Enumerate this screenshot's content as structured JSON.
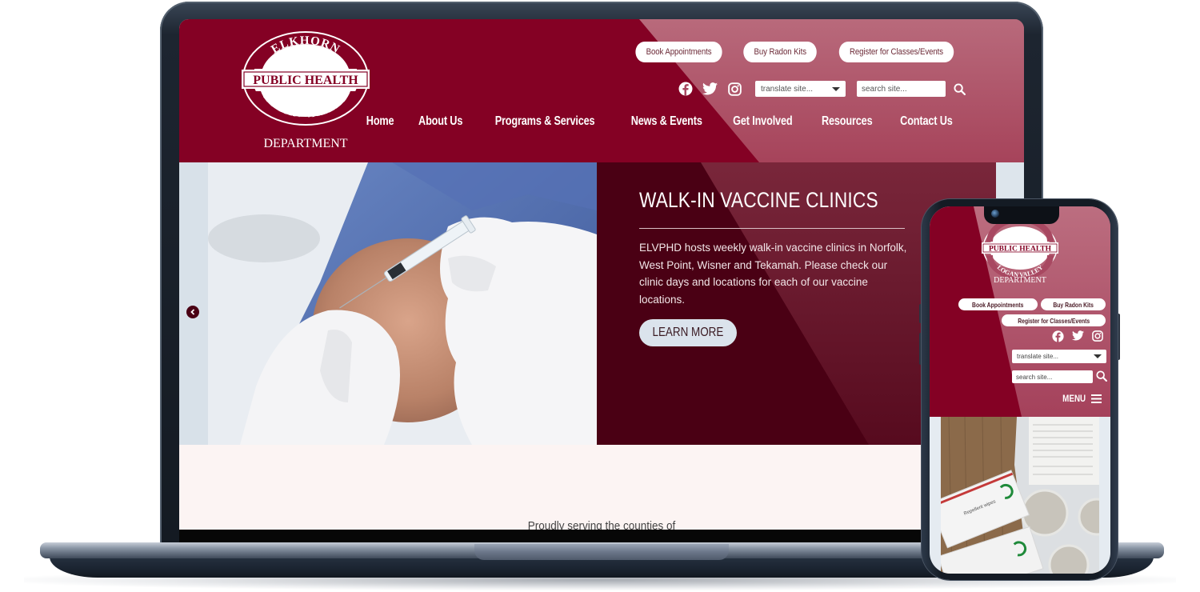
{
  "site": {
    "logo": {
      "top_text": "ELKHORN",
      "band_text": "PUBLIC HEALTH",
      "bottom_text": "LOGAN VALLEY",
      "department": "DEPARTMENT"
    },
    "utility_buttons": [
      {
        "label": "Book Appointments"
      },
      {
        "label": "Buy Radon Kits"
      },
      {
        "label": "Register for Classes/Events"
      }
    ],
    "social": [
      {
        "icon": "facebook-icon"
      },
      {
        "icon": "twitter-icon"
      },
      {
        "icon": "instagram-icon"
      }
    ],
    "translate": {
      "selected": "translate site..."
    },
    "search": {
      "placeholder": "search site..."
    },
    "nav": [
      {
        "label": "Home"
      },
      {
        "label": "About Us"
      },
      {
        "label": "Programs & Services"
      },
      {
        "label": "News & Events"
      },
      {
        "label": "Get Involved"
      },
      {
        "label": "Resources"
      },
      {
        "label": "Contact Us"
      }
    ],
    "hero": {
      "title": "WALK-IN VACCINE CLINICS",
      "text": "ELVPHD hosts weekly walk-in vaccine clinics in Norfolk, West Point, Wisner and Tekamah. Please check our clinic days and locations for each of our vaccine locations.",
      "cta": "LEARN MORE"
    },
    "counties_heading": "Proudly serving the counties of"
  },
  "mobile": {
    "menu_label": "MENU"
  },
  "colors": {
    "brand": "#840124",
    "brand_dark": "#4a0014",
    "light": "#dbe3ec"
  }
}
